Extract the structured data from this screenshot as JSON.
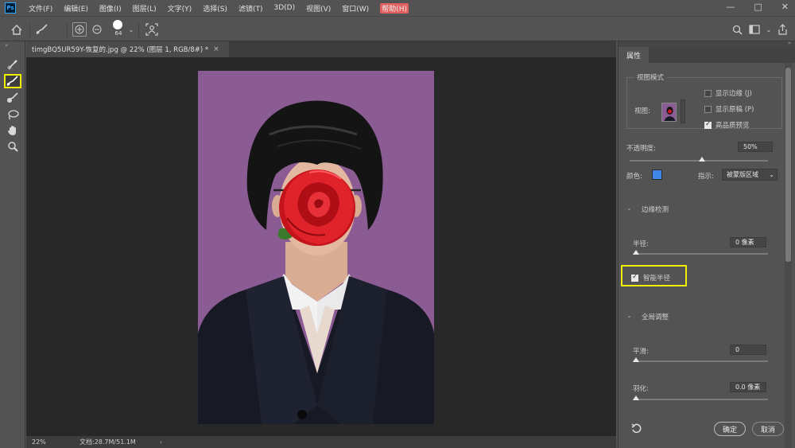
{
  "app": {
    "logo": "Ps"
  },
  "menu": [
    "文件(F)",
    "编辑(E)",
    "图像(I)",
    "图层(L)",
    "文字(Y)",
    "选择(S)",
    "滤镜(T)",
    "3D(D)",
    "视图(V)",
    "窗口(W)",
    "帮助(H)"
  ],
  "window_controls": {
    "minimize": "—",
    "maximize": "□",
    "close": "✕"
  },
  "options": {
    "brush_size": "64"
  },
  "document": {
    "tab_title": "timgBQ5UR59Y-恢复的.jpg @ 22% (图层 1, RGB/8#) *",
    "close": "×",
    "zoom": "22%",
    "doc_size": "文档:28.7M/51.1M",
    "status_arrow": "›"
  },
  "panel": {
    "tab": "属性",
    "view_mode": {
      "title": "视图模式",
      "view_label": "视图:",
      "show_edge": "显示边缘 (J)",
      "show_edge_checked": false,
      "show_original": "显示原稿 (P)",
      "show_original_checked": false,
      "hq_preview": "高品质预览",
      "hq_preview_checked": true
    },
    "opacity_label": "不透明度:",
    "opacity_value": "50%",
    "opacity_fraction": 0.5,
    "color_label": "颜色:",
    "color_value": "#3f86e6",
    "indicate_label": "指示:",
    "indicate_value": "被蒙版区域",
    "edge_detection": {
      "title": "边缘检测",
      "radius_label": "半径:",
      "radius_value": "0 像素",
      "radius_fraction": 0.0,
      "smart_radius": "智能半径",
      "smart_radius_checked": true
    },
    "global_refine": {
      "title": "全局调整",
      "smooth_label": "平滑:",
      "smooth_value": "0",
      "smooth_fraction": 0.0,
      "feather_label": "羽化:",
      "feather_value": "0.0 像素",
      "feather_fraction": 0.0
    },
    "ok_label": "确定",
    "cancel_label": "取消"
  }
}
